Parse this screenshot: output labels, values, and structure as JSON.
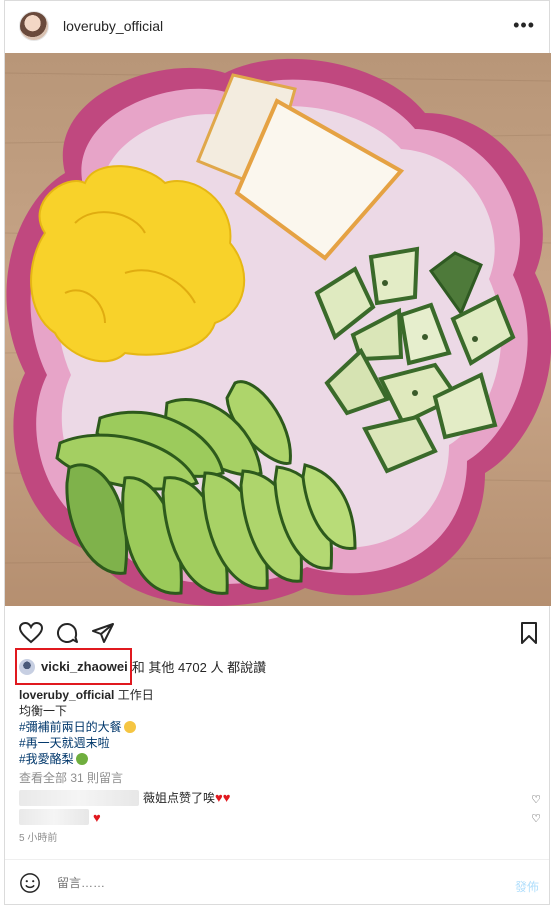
{
  "header": {
    "username": "loveruby_official",
    "more_label": "•••"
  },
  "post": {
    "image_alt": "Breakfast plate with scrambled eggs, bread, zucchini and avocado"
  },
  "actions": {
    "like_icon": "heart-outline-icon",
    "comment_icon": "comment-bubble-icon",
    "share_icon": "paper-plane-icon",
    "save_icon": "bookmark-icon"
  },
  "likes": {
    "liker": "vicki_zhaowei",
    "rest": "和 其他 4702 人 都說讚"
  },
  "caption": {
    "author": "loveruby_official",
    "line1": "工作日",
    "line2": "均衡一下",
    "tag1": "#彌補前兩日的大餐",
    "tag2": "#再一天就週末啦",
    "tag3": "#我愛酪梨"
  },
  "comments": {
    "view_all": "查看全部 31 則留言",
    "comment1_text": "薇姐点赞了唉",
    "comment1_hearts": "♥♥",
    "comment2_hearts": "♥",
    "timestamp": "5 小時前"
  },
  "composer": {
    "placeholder": "留言……",
    "post_label": "發佈"
  },
  "colors": {
    "highlight": "#e0191f",
    "link": "#00376b",
    "muted": "#8e8e8e"
  }
}
